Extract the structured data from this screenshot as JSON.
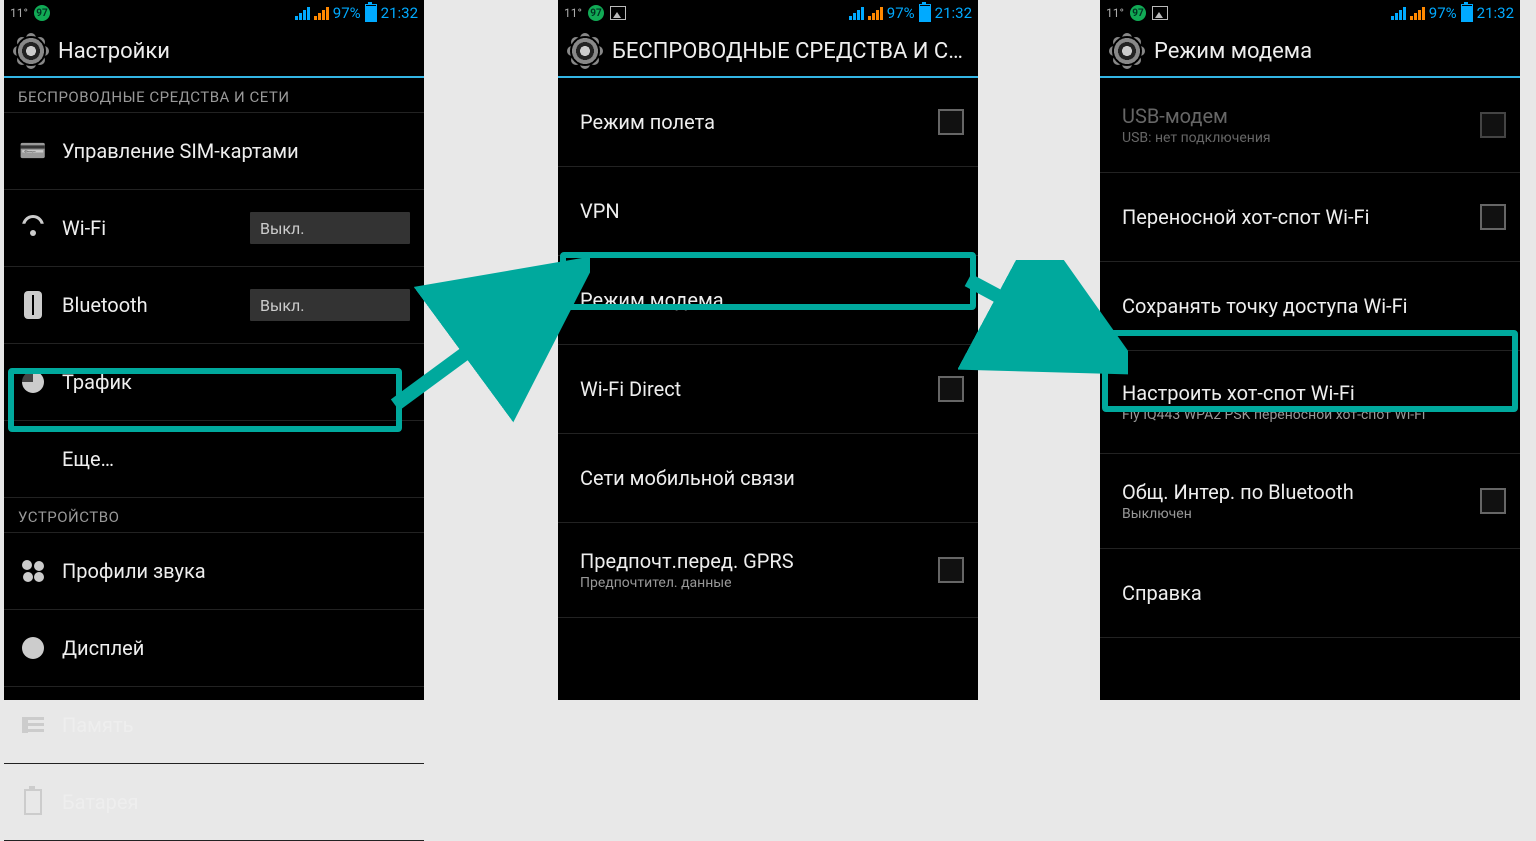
{
  "status": {
    "temp": "11°",
    "badge": "97",
    "percent": "97%",
    "time": "21:32"
  },
  "screen1": {
    "title": "Настройки",
    "cat_wireless": "БЕСПРОВОДНЫЕ СРЕДСТВА И СЕТИ",
    "sim": "Управление SIM-картами",
    "wifi": "Wi-Fi",
    "wifi_state": "Выкл.",
    "bt": "Bluetooth",
    "bt_state": "Выкл.",
    "traffic": "Трафик",
    "more": "Еще…",
    "cat_device": "УСТРОЙСТВО",
    "audio": "Профили звука",
    "display": "Дисплей",
    "memory": "Память",
    "battery": "Батарея"
  },
  "screen2": {
    "title": "БЕСПРОВОДНЫЕ СРЕДСТВА И СЕ…",
    "airplane": "Режим полета",
    "vpn": "VPN",
    "tether": "Режим модема",
    "wifi_direct": "Wi-Fi Direct",
    "mobile_net": "Сети мобильной связи",
    "gprs": "Предпочт.перед. GPRS",
    "gprs_sub": "Предпочтител. данные"
  },
  "screen3": {
    "title": "Режим модема",
    "usb": "USB-модем",
    "usb_sub": "USB: нет подключения",
    "hotspot": "Переносной хот-спот Wi-Fi",
    "keep": "Сохранять точку доступа Wi-Fi",
    "configure": "Настроить хот-спот Wi-Fi",
    "configure_sub": "Fly IQ443 WPA2 PSK переносной хот-спот Wi-Fi",
    "bt_share": "Общ. Интер. по Bluetooth",
    "bt_share_sub": "Выключен",
    "help": "Справка"
  }
}
